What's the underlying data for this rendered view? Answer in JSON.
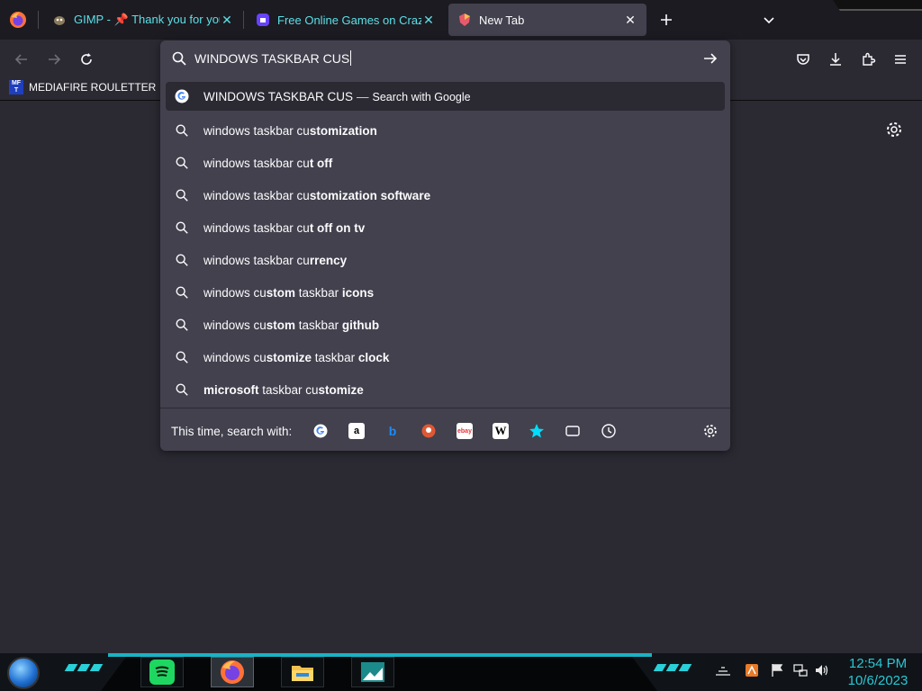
{
  "colors": {
    "accent_cyan": "#5de0e6",
    "toolbar_bg": "#2b2a33",
    "urlbar_bg": "#42414d",
    "tabstrip_bg": "#1c1b22",
    "taskbar_accent": "#1ab3c4"
  },
  "tabs": [
    {
      "label": "GIMP - 📌 Thank you for your s",
      "icon": "gimp-icon",
      "active": false
    },
    {
      "label": "Free Online Games on CrazyGa",
      "icon": "crazygames-icon",
      "active": false
    },
    {
      "label": "New Tab",
      "icon": "newtab-icon",
      "active": true
    }
  ],
  "toolbar": {
    "back_icon": "arrow-left-icon",
    "forward_icon": "arrow-right-icon",
    "reload_icon": "reload-icon",
    "pocket_icon": "pocket-icon",
    "downloads_icon": "download-icon",
    "extensions_icon": "puzzle-icon",
    "menu_icon": "hamburger-icon"
  },
  "bookmarks": [
    {
      "label": "MEDIAFIRE ROULETTER",
      "icon_text": "MF T"
    }
  ],
  "urlbar": {
    "value": "WINDOWS TASKBAR CUS",
    "heuristic": {
      "query": "WINDOWS TASKBAR CUS",
      "separator": "—",
      "action": "Search with Google"
    },
    "suggestions": [
      {
        "prefix": "windows taskbar cu",
        "bold": "stomization",
        "rest": "",
        "bold2": ""
      },
      {
        "prefix": "windows taskbar cu",
        "bold": "t off",
        "rest": "",
        "bold2": ""
      },
      {
        "prefix": "windows taskbar cu",
        "bold": "stomization software",
        "rest": "",
        "bold2": ""
      },
      {
        "prefix": "windows taskbar cu",
        "bold": "t off on tv",
        "rest": "",
        "bold2": ""
      },
      {
        "prefix": "windows taskbar cu",
        "bold": "rrency",
        "rest": "",
        "bold2": ""
      },
      {
        "prefix": "windows cu",
        "bold": "stom",
        "rest": " taskbar ",
        "bold2": "icons"
      },
      {
        "prefix": "windows cu",
        "bold": "stom",
        "rest": " taskbar ",
        "bold2": "github"
      },
      {
        "prefix": "windows cu",
        "bold": "stomize",
        "rest": " taskbar ",
        "bold2": "clock"
      },
      {
        "prefix": "",
        "bold": "microsoft",
        "rest": " taskbar cu",
        "bold2": "stomize"
      }
    ],
    "oneoff_label": "This time, search with:",
    "engines": [
      "google",
      "amazon",
      "bing",
      "duckduckgo",
      "ebay",
      "wikipedia",
      "bookmarks",
      "tabs",
      "history"
    ]
  },
  "clock": {
    "time": "12:54 PM",
    "date": "10/6/2023"
  }
}
